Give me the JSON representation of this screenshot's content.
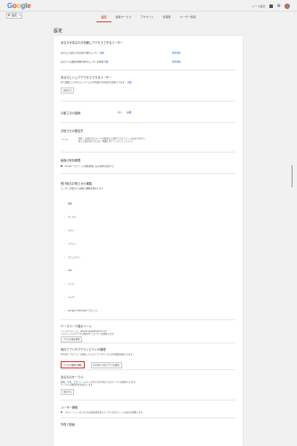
{
  "header": {
    "logo_letters": [
      {
        "char": "G",
        "color": "#4285f4"
      },
      {
        "char": "o",
        "color": "#ea4335"
      },
      {
        "char": "o",
        "color": "#fbbc05"
      },
      {
        "char": "g",
        "color": "#4285f4"
      },
      {
        "char": "l",
        "color": "#34a853"
      },
      {
        "char": "e",
        "color": "#ea4335"
      }
    ],
    "account_label": "設定",
    "top_link": "メール設定",
    "accent_color": "#d14836"
  },
  "tabs": [
    {
      "label": "設定",
      "active": true
    },
    {
      "label": "連携サービス",
      "active": false
    },
    {
      "label": "アカウント",
      "active": false
    },
    {
      "label": "管理者",
      "active": false
    },
    {
      "label": "ユーザー情報",
      "active": false
    }
  ],
  "page_title": "設定",
  "sections": {
    "delegation": {
      "title": "あなたがあなたの情報にアクセスできるユーザー",
      "rows": [
        {
          "label": "あなたにお知らせを送信可能なユーザー",
          "link": "詳細",
          "action": "基本情報"
        },
        {
          "label": "あなたへの通知を閲覧可能なユーザーを管理",
          "link": "詳細",
          "action": "基本情報"
        }
      ]
    },
    "shared": {
      "title": "あなたにシェアアクセスできるユーザー",
      "desc": "同じ組織にいる次のユーザーのみが情報の共有設定を変更できます。",
      "desc_link": "詳細",
      "button": "追加する"
    },
    "invite": {
      "title": "お客さまの接続",
      "status": "オン",
      "link": "詳細"
    },
    "profile": {
      "title": "お知らせの配信先",
      "label": "メール",
      "desc1": "現在、お知らせのメールの配信先に設定されたアドレスはありません。",
      "desc2": "新しい設定を行うには、[編集] をクリックしてください。"
    },
    "theme": {
      "title": "画像の有効期限",
      "checkbox": "Google アカウントの関連情報にある画像を追加する"
    },
    "services": {
      "title": "受け取るお知らせの種類",
      "desc": "ユーザーが受信する通知の種類を選択します",
      "items": [
        "情報",
        "サークル",
        "フォト",
        "イベント",
        "コミュニティ",
        "Hub",
        "ページ",
        "ヘルプ",
        "Google+ Business アカウント"
      ]
    },
    "mail_delivery": {
      "title": "テーマパーク用のツール",
      "desc1": "ページのアドレス：sample.page@gmail.com",
      "desc2": "このページへのアクセス権を持つユーザーを確認します。",
      "button": "アクセス権を確認"
    },
    "manage": {
      "title": "他のアプリやアクティビティの管理",
      "desc": "Google アカウントで接続しているアプリやサービスの情報を確認できます。",
      "button_red": "アクセス権限へ移動",
      "button_gray": "Google+ 用のアプリを確認"
    },
    "circles": {
      "title": "あなたのサークル",
      "desc1": "情報、写真、プロフィールデータなどの共有先となるサークルを選択できます。",
      "desc2": "サークルの更新内容を表示します。",
      "button": "設定する"
    },
    "user_help": {
      "title": "ユーザー補助",
      "checkbox": "スクリーンリーダーなどの支援技術を使うユーザー向けにページの表示を調整します。"
    },
    "photos": {
      "title": "写真と動画"
    }
  }
}
